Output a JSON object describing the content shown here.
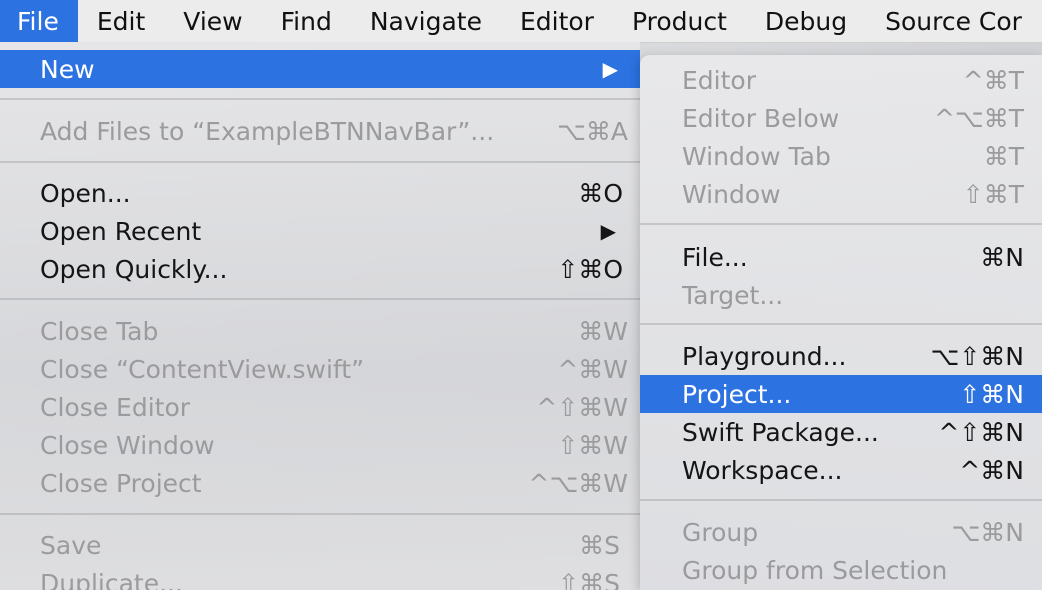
{
  "menubar": {
    "items": [
      "File",
      "Edit",
      "View",
      "Find",
      "Navigate",
      "Editor",
      "Product",
      "Debug",
      "Source Cor"
    ]
  },
  "file_menu": {
    "new": {
      "label": "New",
      "arrow": "▶"
    },
    "add_files": {
      "label": "Add Files to “ExampleBTNNavBar”...",
      "shortcut": "⌥⌘A"
    },
    "open": {
      "label": "Open...",
      "shortcut": "⌘O"
    },
    "open_recent": {
      "label": "Open Recent",
      "arrow": "▶"
    },
    "open_quickly": {
      "label": "Open Quickly...",
      "shortcut": "⇧⌘O"
    },
    "close_tab": {
      "label": "Close Tab",
      "shortcut": "⌘W"
    },
    "close_file": {
      "label": "Close “ContentView.swift”",
      "shortcut": "^⌘W"
    },
    "close_editor": {
      "label": "Close Editor",
      "shortcut": "^⇧⌘W"
    },
    "close_window": {
      "label": "Close Window",
      "shortcut": "⇧⌘W"
    },
    "close_project": {
      "label": "Close Project",
      "shortcut": "^⌥⌘W"
    },
    "save": {
      "label": "Save",
      "shortcut": "⌘S"
    },
    "duplicate": {
      "label": "Duplicate...",
      "shortcut": "⇧⌘S"
    }
  },
  "new_submenu": {
    "editor": {
      "label": "Editor",
      "shortcut": "^⌘T"
    },
    "editor_below": {
      "label": "Editor Below",
      "shortcut": "^⌥⌘T"
    },
    "window_tab": {
      "label": "Window Tab",
      "shortcut": "⌘T"
    },
    "window": {
      "label": "Window",
      "shortcut": "⇧⌘T"
    },
    "file": {
      "label": "File...",
      "shortcut": "⌘N"
    },
    "target": {
      "label": "Target..."
    },
    "playground": {
      "label": "Playground...",
      "shortcut": "⌥⇧⌘N"
    },
    "project": {
      "label": "Project...",
      "shortcut": "⇧⌘N"
    },
    "swift_package": {
      "label": "Swift Package...",
      "shortcut": "^⇧⌘N"
    },
    "workspace": {
      "label": "Workspace...",
      "shortcut": "^⌘N"
    },
    "group": {
      "label": "Group",
      "shortcut": "⌥⌘N"
    },
    "group_from_selection": {
      "label": "Group from Selection"
    }
  },
  "colors": {
    "highlight": "#2c72e0",
    "disabled": "#9b9b9d"
  }
}
